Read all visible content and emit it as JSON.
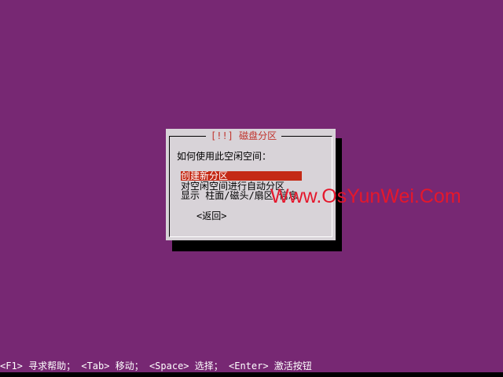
{
  "dialog": {
    "title": "[!!] 磁盘分区",
    "question": "如何使用此空闲空间：",
    "options": [
      {
        "label": "创建新分区",
        "selected": true
      },
      {
        "label": "对空闲空间进行自动分区",
        "selected": false
      },
      {
        "label": "显示 柱面/磁头/扇区 信息",
        "selected": false
      }
    ],
    "back_label": "<返回>"
  },
  "watermark": "Www.OsYunWei.Com",
  "status_bar": {
    "f1": "<F1> 寻求帮助；",
    "tab": "<Tab> 移动；",
    "space": "<Space> 选择；",
    "enter": "<Enter> 激活按钮"
  },
  "colors": {
    "background": "#772873",
    "dialog": "#d8d3d8",
    "title_text": "#c0322b",
    "selection": "#c42a16",
    "watermark": "#e5172c"
  }
}
